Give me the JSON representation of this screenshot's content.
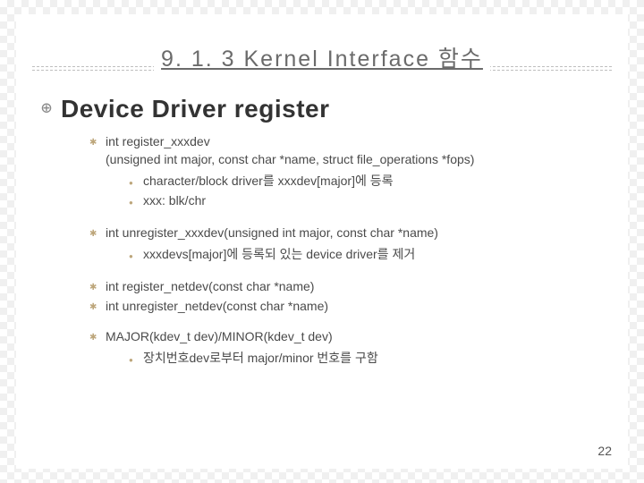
{
  "heading": "9. 1. 3 Kernel Interface 함수",
  "subheading": "Device Driver register",
  "items": [
    {
      "lines": [
        "int register_xxxdev",
        "(unsigned int major, const char *name, struct file_operations *fops)"
      ],
      "sub": [
        "character/block driver를 xxxdev[major]에 등록",
        "xxx: blk/chr"
      ]
    },
    {
      "lines": [
        "int unregister_xxxdev(unsigned int major, const char *name)"
      ],
      "sub": [
        "xxxdevs[major]에 등록되 있는 device driver를 제거"
      ]
    },
    {
      "lines": [
        "int register_netdev(const char *name)"
      ],
      "sub": []
    },
    {
      "lines": [
        "int unregister_netdev(const char *name)"
      ],
      "sub": []
    },
    {
      "lines": [
        "MAJOR(kdev_t dev)/MINOR(kdev_t dev)"
      ],
      "sub": [
        "장치번호dev로부터 major/minor 번호를 구함"
      ]
    }
  ],
  "page": "22"
}
